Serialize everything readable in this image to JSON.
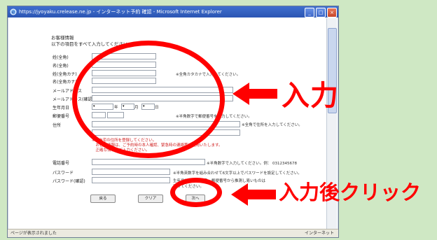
{
  "window": {
    "title": "https://jyoyaku.crelease.ne.jp - インターネット予約 確認 - Microsoft Internet Explorer",
    "buttons": {
      "minimize": "_",
      "maximize": "□",
      "close": "×"
    }
  },
  "form": {
    "heading_line1": "お客様情報",
    "heading_line2": "以下の項目をすべて入力してください。",
    "labels": {
      "last_name": "姓(全角)",
      "first_name": "名(全角)",
      "last_name_kana": "姓(全角カナ)",
      "first_name_kana": "名(全角カナ)",
      "email": "メールアドレス",
      "email_confirm": "メールアドレス(確認)",
      "birthday": "生年月日",
      "postal_code": "郵便番号",
      "address": "住所",
      "phone": "電話番号",
      "password": "パスワード",
      "password_confirm": "パスワード(確認)"
    },
    "notes": {
      "kana": "※全角カタカナで入力してください。",
      "postal": "※半角数字で郵便番号を入力してください。",
      "address": "※全角で住所を入力してください。",
      "phone": "※半角数字で入力してください。例： 0312345678",
      "password_line1": "※半角英数字を組み合わせて6文字以上でパスワードを設定してください。",
      "password_line2": "生年月日・電話番号・郵便番号から推測し易いものは",
      "password_line3": "避けてください。"
    },
    "red_notes": [
      "※ご自宅の住所を登録してください。",
      "　お客様情報は、ご予約時の本人確認、緊急時の連絡等に使用いたします。",
      "　正確な情報をご入力ください。"
    ],
    "date_units": {
      "year": "年",
      "month": "月",
      "day": "日"
    },
    "buttons": {
      "back": "戻る",
      "clear": "クリア",
      "next": "次へ"
    }
  },
  "annotations": {
    "input_label": "入力",
    "click_label": "入力後クリック",
    "color": "#ff0000"
  },
  "statusbar": {
    "left": "ページが表示されました",
    "right": "インターネット"
  }
}
